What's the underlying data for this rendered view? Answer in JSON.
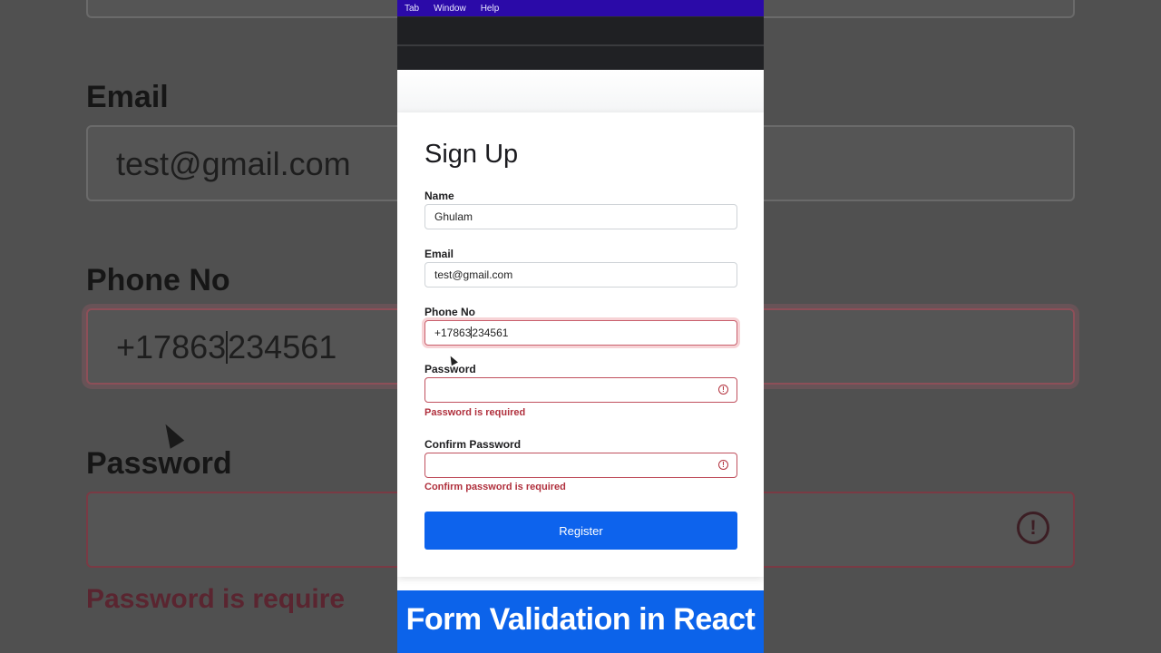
{
  "menubar": {
    "items": [
      "Tab",
      "Window",
      "Help"
    ]
  },
  "form": {
    "title": "Sign Up",
    "name_label": "Name",
    "name_value": "Ghulam",
    "email_label": "Email",
    "email_value": "test@gmail.com",
    "phone_label": "Phone No",
    "phone_value_before_caret": "+17863",
    "phone_value_after_caret": "234561",
    "password_label": "Password",
    "password_error": "Password is required",
    "confirm_label": "Confirm Password",
    "confirm_error": "Confirm password is required",
    "register_label": "Register"
  },
  "background": {
    "email_label": "Email",
    "email_value": "test@gmail.com",
    "phone_label": "Phone No",
    "phone_value_before_caret": "+17863",
    "phone_value_after_caret": "234561",
    "password_label": "Password",
    "password_error": "Password is require"
  },
  "banner": {
    "text": "Form Validation in React"
  },
  "colors": {
    "primary": "#0d63ed",
    "error": "#b0303d",
    "menubar": "#2b0aa8"
  },
  "icons": [
    "alert-circle-icon",
    "mouse-cursor-icon"
  ]
}
